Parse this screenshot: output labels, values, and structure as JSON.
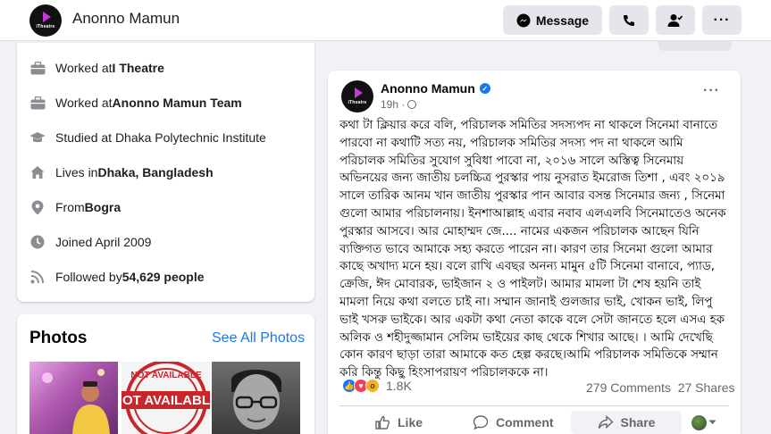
{
  "header": {
    "profile_name": "Anonno Mamun",
    "logo_text": "iTheatre",
    "message_label": "Message"
  },
  "intro": {
    "items": [
      {
        "prefix": "Worked at ",
        "bold": "I Theatre",
        "suffix": "",
        "icon": "briefcase-icon"
      },
      {
        "prefix": "Worked at ",
        "bold": "Anonno Mamun Team",
        "suffix": "",
        "icon": "briefcase-icon"
      },
      {
        "prefix": "Studied at Dhaka Polytechnic Institute",
        "bold": "",
        "suffix": "",
        "icon": "graduation-cap-icon"
      },
      {
        "prefix": "Lives in ",
        "bold": "Dhaka, Bangladesh",
        "suffix": "",
        "icon": "home-icon"
      },
      {
        "prefix": "From ",
        "bold": "Bogra",
        "suffix": "",
        "icon": "location-pin-icon"
      },
      {
        "prefix": "Joined April 2009",
        "bold": "",
        "suffix": "",
        "icon": "clock-icon"
      },
      {
        "prefix": "Followed by ",
        "bold": "54,629 people",
        "suffix": "",
        "icon": "rss-icon"
      }
    ]
  },
  "photos": {
    "title": "Photos",
    "see_all": "See All Photos",
    "stamp_text": "NOT AVAILABLE",
    "stamp_big": "OT AVAILABL"
  },
  "post": {
    "author": "Anonno Mamun",
    "time": "19h · ",
    "more": "···",
    "text": "কথা টা ক্লিয়ার করে বলি, পরিচালক সমিতির সদস্যপদ না থাকলে সিনেমা বানাতে পারবো না কথাটি সত্য নয়, পরিচালক সমিতির সদস্য পদ না থাকলে আমি পরিচালক সমিতির সুযোগ সুবিধা পাবো না, ২০১৬ সালে অস্তিত্ব সিনেমায় অভিনয়ের জন্য জাতীয় চলচ্চিত্র পুরস্কার পায় নুসরাত ইমরোজ তিশা , এবং ২০১৯ সালে তারিক আনম খান জাতীয় পুরস্কার পান আবার বসন্ত সিনেমার জন্য , সিনেমা গুলো আমার পরিচালনায়। ইনশাআল্লাহ এবার নবাব এলএলবি সিনেমাতেও অনেক পুরস্কার আসবে। আর মোহাম্মদ জে.... নামের একজন পরিচালক আছেন যিনি ব্যক্তিগত ভাবে আমাকে সহ্য করতে পারেন না। কারণ তার সিনেমা গুলো আমার কাছে অখাদ্য মনে হয়। বলে রাখি এবছর অনন্য মামুন ৫টি সিনেমা বানাবে, প্যাড, ক্রেজি, ঈদ মোবারক, ভাইজান ২ ও পাইলট। আমার মামলা টা শেষ হয়নি তাই মামলা নিয়ে কথা বলতে চাই না। সম্মান জানাই গুলজার ভাই, খোকন ভাই, লিপু ভাই খসরু ভাইকে। আর একটা কথা নেতা কাকে বলে সেটা জানতে হলে এসএ হক অলিক ও শহীদুজ্জামান সেলিম ভাইয়ের কাছ থেকে শিখার আছে। । আমি দেখেছি কোন কারণ ছাড়া তারা আমাকে কত হেল্প করছে।আমি পরিচালক সমিতিকে সম্মান করি কিন্তু কিছু হিংসাপরায়ণ  পরিচালককে না।",
    "reaction_count": "1.8K",
    "comments": "279 Comments",
    "shares": "27 Shares",
    "like_label": "Like",
    "comment_label": "Comment",
    "share_label": "Share"
  },
  "colors": {
    "accent": "#1877f2",
    "secondary_text": "#65676b",
    "background": "#f0f2f5"
  }
}
